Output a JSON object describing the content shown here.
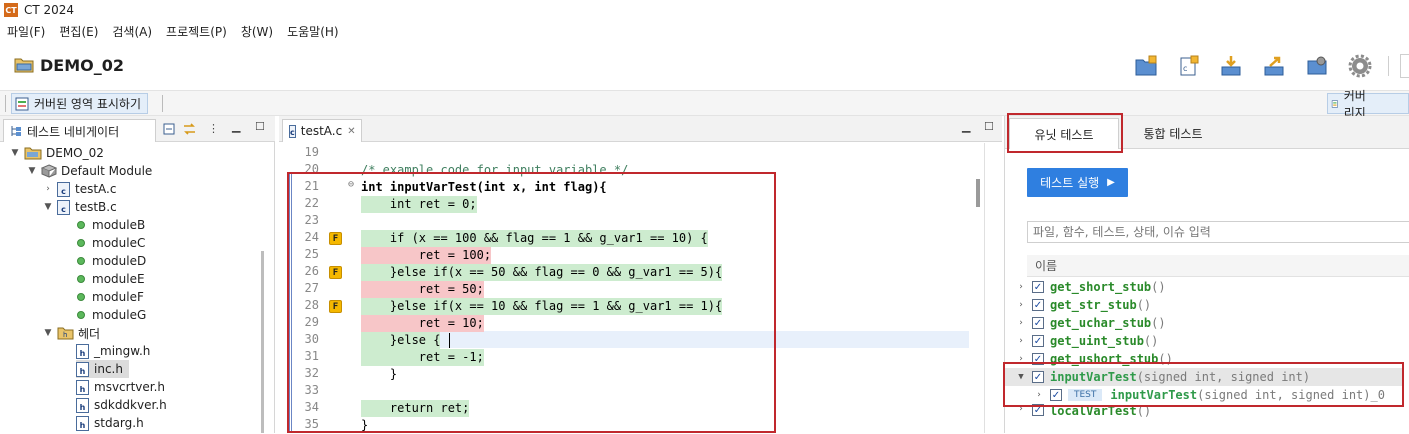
{
  "app": {
    "title": "CT 2024",
    "logo_text": "CT"
  },
  "menu": [
    "파일(F)",
    "편집(E)",
    "검색(A)",
    "프로젝트(P)",
    "창(W)",
    "도움말(H)"
  ],
  "project": {
    "name": "DEMO_02"
  },
  "toolbar": {
    "show_covered_label": "커버된 영역 표시하기",
    "coverage_label": "커버리지",
    "icons": [
      "new-project-icon",
      "new-file-icon",
      "import-icon",
      "export-icon",
      "camera-icon",
      "settings-gear-icon"
    ]
  },
  "navigator": {
    "title": "테스트 네비게이터",
    "tree": [
      {
        "label": "DEMO_02",
        "icon": "project-folder-icon",
        "expanded": true
      },
      {
        "label": "Default Module",
        "icon": "module-icon",
        "expanded": true
      },
      {
        "label": "testA.c",
        "icon": "c-file-icon",
        "expanded": false
      },
      {
        "label": "testB.c",
        "icon": "c-file-icon",
        "expanded": true
      },
      {
        "label": "moduleB",
        "icon": "function-dot-icon"
      },
      {
        "label": "moduleC",
        "icon": "function-dot-icon"
      },
      {
        "label": "moduleD",
        "icon": "function-dot-icon"
      },
      {
        "label": "moduleE",
        "icon": "function-dot-icon"
      },
      {
        "label": "moduleF",
        "icon": "function-dot-icon"
      },
      {
        "label": "moduleG",
        "icon": "function-dot-icon"
      },
      {
        "label": "헤더",
        "icon": "header-folder-icon",
        "expanded": true
      },
      {
        "label": "_mingw.h",
        "icon": "h-file-icon"
      },
      {
        "label": "inc.h",
        "icon": "h-file-icon",
        "selected": true
      },
      {
        "label": "msvcrtver.h",
        "icon": "h-file-icon"
      },
      {
        "label": "sdkddkver.h",
        "icon": "h-file-icon"
      },
      {
        "label": "stdarg.h",
        "icon": "h-file-icon"
      }
    ]
  },
  "editor": {
    "tab_label": "testA.c",
    "close_glyph": "✕",
    "lines": [
      {
        "n": "19",
        "code": "",
        "cov": ""
      },
      {
        "n": "20",
        "code": "/* example code for input variable */",
        "cov": "comment"
      },
      {
        "n": "21",
        "code": "int inputVarTest(int x, int flag){",
        "cov": ""
      },
      {
        "n": "22",
        "code": "    int ret = 0;",
        "cov": "covered"
      },
      {
        "n": "23",
        "code": "",
        "cov": ""
      },
      {
        "n": "24",
        "code": "    if (x == 100 && flag == 1 && g_var1 == 10) {",
        "cov": "covered",
        "flag": "F"
      },
      {
        "n": "25",
        "code": "        ret = 100;",
        "cov": "uncovered"
      },
      {
        "n": "26",
        "code": "    }else if(x == 50 && flag == 0 && g_var1 == 5){",
        "cov": "covered",
        "flag": "F"
      },
      {
        "n": "27",
        "code": "        ret = 50;",
        "cov": "uncovered"
      },
      {
        "n": "28",
        "code": "    }else if(x == 10 && flag == 1 && g_var1 == 1){",
        "cov": "covered",
        "flag": "F"
      },
      {
        "n": "29",
        "code": "        ret = 10;",
        "cov": "uncovered"
      },
      {
        "n": "30",
        "code": "    }else {",
        "cov": "covered"
      },
      {
        "n": "31",
        "code": "        ret = -1;",
        "cov": "covered"
      },
      {
        "n": "32",
        "code": "    }",
        "cov": ""
      },
      {
        "n": "33",
        "code": "",
        "cov": ""
      },
      {
        "n": "34",
        "code": "    return ret;",
        "cov": "covered"
      },
      {
        "n": "35",
        "code": "}",
        "cov": ""
      }
    ]
  },
  "right_panel": {
    "tabs": [
      "유닛 테스트",
      "통합 테스트"
    ],
    "run_button": "테스트 실행",
    "filter_placeholder": "파일, 함수, 테스트, 상태, 이슈 입력",
    "column_header": "이름",
    "tests": [
      {
        "name": "get_short_stub",
        "args": "()"
      },
      {
        "name": "get_str_stub",
        "args": "()"
      },
      {
        "name": "get_uchar_stub",
        "args": "()"
      },
      {
        "name": "get_uint_stub",
        "args": "()"
      },
      {
        "name": "get_ushort_stub",
        "args": "()"
      },
      {
        "name": "inputVarTest",
        "args": "(signed int, signed int)",
        "expanded": true
      },
      {
        "name": "inputVarTest",
        "args": "(signed int, signed int)_0",
        "badge": "TEST",
        "child": true
      },
      {
        "name": "localVarTest",
        "args": "()"
      }
    ]
  }
}
